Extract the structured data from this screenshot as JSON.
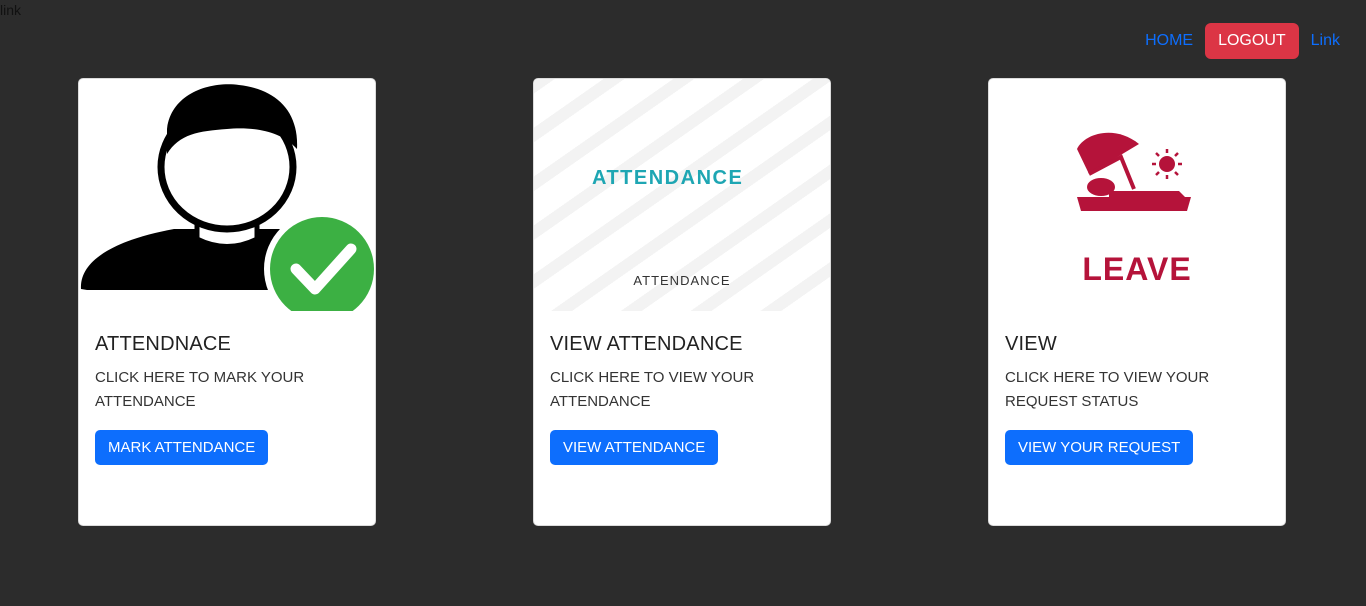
{
  "corner_link": "link",
  "nav": {
    "home": "HOME",
    "logout": "LOGOUT",
    "link": "Link"
  },
  "colors": {
    "background": "#2c2c2c",
    "primary": "#0d6efd",
    "danger": "#dc3545",
    "leave_red": "#b5133a",
    "attendance_teal": "#1ea6b3",
    "check_green": "#3cb043"
  },
  "cards": [
    {
      "image_icon": "person-check-icon",
      "title": "ATTENDNACE",
      "text": "CLICK HERE TO MARK YOUR ATTENDANCE",
      "button": "MARK ATTENDANCE"
    },
    {
      "image_icon": "attendance-logo",
      "image_logo_text": "ATTENDANCE",
      "image_caption": "ATTENDANCE",
      "title": "VIEW ATTENDANCE",
      "text": "CLICK HERE TO VIEW YOUR ATTENDANCE",
      "button": "VIEW ATTENDANCE"
    },
    {
      "image_icon": "beach-umbrella-icon",
      "image_text": "LEAVE",
      "title": "VIEW",
      "text": "CLICK HERE TO VIEW YOUR REQUEST STATUS",
      "button": "VIEW YOUR REQUEST"
    }
  ]
}
